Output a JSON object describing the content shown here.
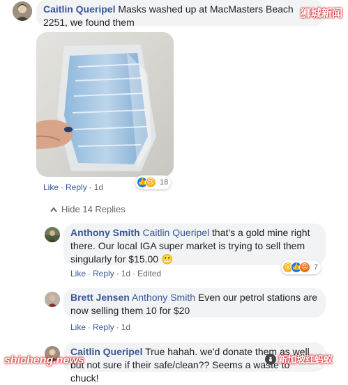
{
  "watermark_top": "狮城新闻",
  "watermark_bottom_left": "shicheng.news",
  "watermark_bottom_right": "新加坡红蚂蚁",
  "comment1": {
    "author": "Caitlin Queripel",
    "text": "Masks washed up at MacMasters Beach 2251, we found them",
    "actions": {
      "like": "Like",
      "reply": "Reply",
      "time": "1d"
    },
    "reactions": {
      "count": "18",
      "icons": [
        "like",
        "sad"
      ]
    }
  },
  "hide_replies": "Hide 14 Replies",
  "reply1": {
    "author": "Anthony Smith",
    "mention": "Caitlin Queripel",
    "text": "that's a gold mine right there. Our local IGA super market is trying to sell them singularly for $15.00",
    "emoji": "😬",
    "actions": {
      "like": "Like",
      "reply": "Reply",
      "time": "1d",
      "edited": "Edited"
    },
    "reactions": {
      "count": "7",
      "icons": [
        "wow",
        "like",
        "angry"
      ]
    }
  },
  "reply2": {
    "author": "Brett Jensen",
    "mention": "Anthony Smith",
    "text": "Even our petrol stations are now selling them 10 for $20",
    "actions": {
      "like": "Like",
      "reply": "Reply",
      "time": "1d"
    }
  },
  "reply3": {
    "author": "Caitlin Queripel",
    "text": "True hahah. we'd donate them as well but not sure if their safe/clean?? Seems a waste to chuck!"
  },
  "colors": {
    "link": "#385898",
    "bubble": "#f2f3f5",
    "meta": "#606770",
    "like": "#1877f2"
  }
}
